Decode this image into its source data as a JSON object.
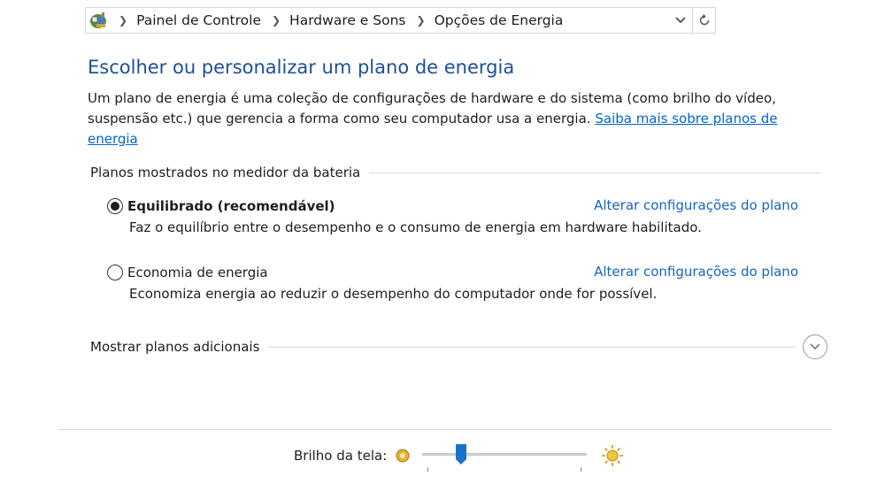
{
  "addressbar": {
    "icon": "control-panel-icon",
    "crumbs": [
      "Painel de Controle",
      "Hardware e Sons",
      "Opções de Energia"
    ],
    "separator": ">",
    "dropdown_icon": "chevron-down-icon",
    "refresh_icon": "refresh-icon"
  },
  "page": {
    "title": "Escolher ou personalizar um plano de energia",
    "description": "Um plano de energia é uma coleção de configurações de hardware e do sistema (como brilho do vídeo, suspensão etc.) que gerencia a forma como seu computador usa a energia.",
    "learn_more_link": "Saiba mais sobre planos de energia"
  },
  "plans_section": {
    "header": "Planos mostrados no medidor da bateria",
    "plans": [
      {
        "name": "Equilibrado (recomendável)",
        "selected": true,
        "change_link": "Alterar configurações do plano",
        "description": "Faz o equilíbrio entre o desempenho e o consumo de energia em hardware habilitado."
      },
      {
        "name": "Economia de energia",
        "selected": false,
        "change_link": "Alterar configurações do plano",
        "description": "Economiza energia ao reduzir o desempenho do computador onde for possível."
      }
    ]
  },
  "additional": {
    "label": "Mostrar planos adicionais",
    "expand_icon": "chevron-down-circle-icon"
  },
  "brightness": {
    "label": "Brilho da tela:",
    "level_percent": 22,
    "dim_icon": "dim-sun-icon",
    "bright_icon": "bright-sun-icon"
  },
  "colors": {
    "title": "#1e4f97",
    "link": "#0066cc",
    "slider_thumb": "#1a73c9"
  }
}
